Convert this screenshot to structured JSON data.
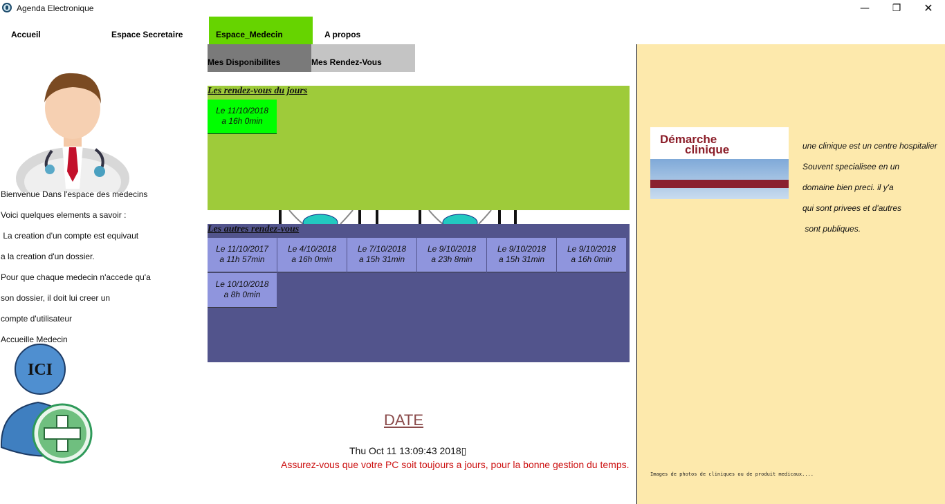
{
  "window": {
    "title": "Agenda Electronique",
    "controls": {
      "minimize": "—",
      "maximize": "❐",
      "close": "✕"
    }
  },
  "nav": {
    "accueil": "Accueil",
    "secretaire": "Espace Secretaire",
    "medecin": "Espace_Medecin",
    "apropos": "A propos",
    "active": "Espace_Medecin",
    "active_color": "#66d400"
  },
  "subtabs": {
    "disponibilites": "Mes Disponibilites",
    "rendezvous": "Mes Rendez-Vous"
  },
  "left": {
    "lines": [
      "Bienvenue Dans l'espace des medecins",
      "Voici quelques elements a savoir :",
      " La creation d'un compte est equivaut",
      "a la creation d'un dossier.",
      "Pour que chaque medecin n'accede qu'a",
      "son dossier, il doit lui creer un",
      "compte d'utilisateur",
      "Accueille Medecin"
    ],
    "ici_label": "ICI"
  },
  "today": {
    "title": "Les rendez-vous du jours",
    "cards": [
      {
        "line1": "Le 11/10/2018",
        "line2": "a 16h 0min"
      }
    ],
    "color": "#9ecb3a"
  },
  "others": {
    "title": "Les autres rendez-vous",
    "cards": [
      {
        "line1": "Le 11/10/2017",
        "line2": "a 11h 57min"
      },
      {
        "line1": "Le 4/10/2018",
        "line2": "a 16h 0min"
      },
      {
        "line1": "Le 7/10/2018",
        "line2": "a 15h 31min"
      },
      {
        "line1": "Le 9/10/2018",
        "line2": "a 23h 8min"
      },
      {
        "line1": "Le 9/10/2018",
        "line2": "a 15h 31min"
      },
      {
        "line1": "Le 9/10/2018",
        "line2": "a 16h 0min"
      },
      {
        "line1": "Le 10/10/2018",
        "line2": "a 8h 0min"
      }
    ],
    "color": "#52548c"
  },
  "date": {
    "title": "DATE",
    "value": "Thu Oct 11 13:09:43 2018▯",
    "warning": "Assurez-vous que votre PC soit toujours a jours, pour la bonne gestion du temps."
  },
  "right": {
    "book_title_1": "Démarche",
    "book_title_2": "clinique",
    "lines": [
      "une clinique est un centre hospitalier",
      "Souvent specialisee en un",
      "domaine bien preci. il y'a",
      "qui sont privees et d'autres",
      " sont publiques."
    ],
    "caption": "Images de photos de cliniques ou de produit medicaux....",
    "background": "#fde9ac"
  }
}
